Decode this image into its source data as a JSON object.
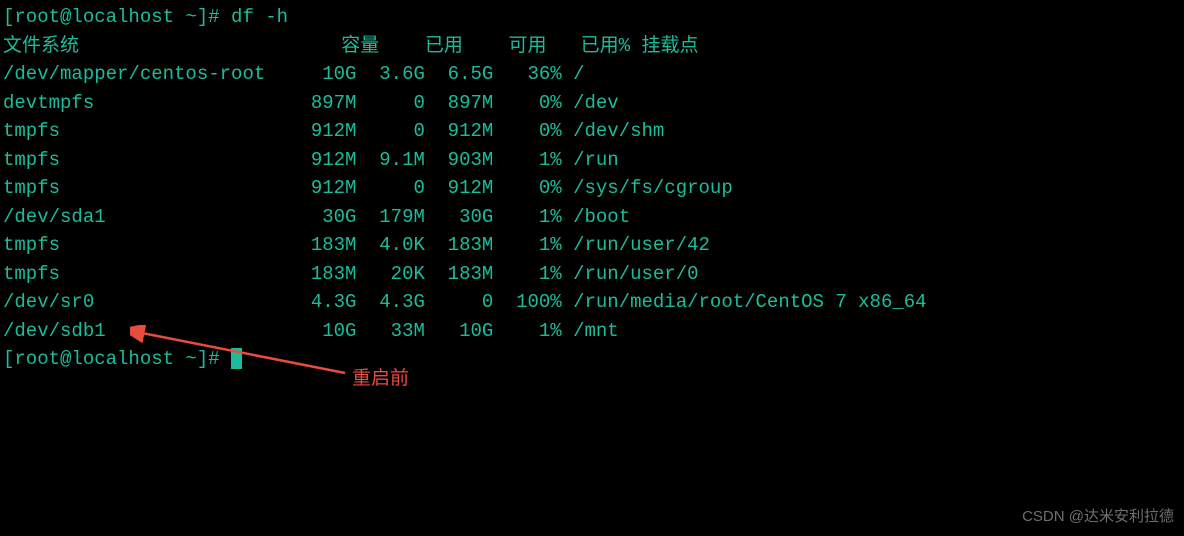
{
  "prompt1": {
    "prefix": "[root@localhost ~]# ",
    "command": "df -h"
  },
  "headers": {
    "filesystem": "文件系统",
    "size": "容量",
    "used": "已用",
    "avail": "可用",
    "usepct": "已用%",
    "mount": "挂载点"
  },
  "rows": [
    {
      "fs": "/dev/mapper/centos-root",
      "size": "10G",
      "used": "3.6G",
      "avail": "6.5G",
      "pct": "36%",
      "mount": "/"
    },
    {
      "fs": "devtmpfs",
      "size": "897M",
      "used": "0",
      "avail": "897M",
      "pct": "0%",
      "mount": "/dev"
    },
    {
      "fs": "tmpfs",
      "size": "912M",
      "used": "0",
      "avail": "912M",
      "pct": "0%",
      "mount": "/dev/shm"
    },
    {
      "fs": "tmpfs",
      "size": "912M",
      "used": "9.1M",
      "avail": "903M",
      "pct": "1%",
      "mount": "/run"
    },
    {
      "fs": "tmpfs",
      "size": "912M",
      "used": "0",
      "avail": "912M",
      "pct": "0%",
      "mount": "/sys/fs/cgroup"
    },
    {
      "fs": "/dev/sda1",
      "size": "30G",
      "used": "179M",
      "avail": "30G",
      "pct": "1%",
      "mount": "/boot"
    },
    {
      "fs": "tmpfs",
      "size": "183M",
      "used": "4.0K",
      "avail": "183M",
      "pct": "1%",
      "mount": "/run/user/42"
    },
    {
      "fs": "tmpfs",
      "size": "183M",
      "used": "20K",
      "avail": "183M",
      "pct": "1%",
      "mount": "/run/user/0"
    },
    {
      "fs": "/dev/sr0",
      "size": "4.3G",
      "used": "4.3G",
      "avail": "0",
      "pct": "100%",
      "mount": "/run/media/root/CentOS 7 x86_64"
    },
    {
      "fs": "/dev/sdb1",
      "size": "10G",
      "used": "33M",
      "avail": "10G",
      "pct": "1%",
      "mount": "/mnt"
    }
  ],
  "prompt2": {
    "prefix": "[root@localhost ~]# "
  },
  "annotation": "重启前",
  "watermark": "CSDN @达米安利拉德"
}
